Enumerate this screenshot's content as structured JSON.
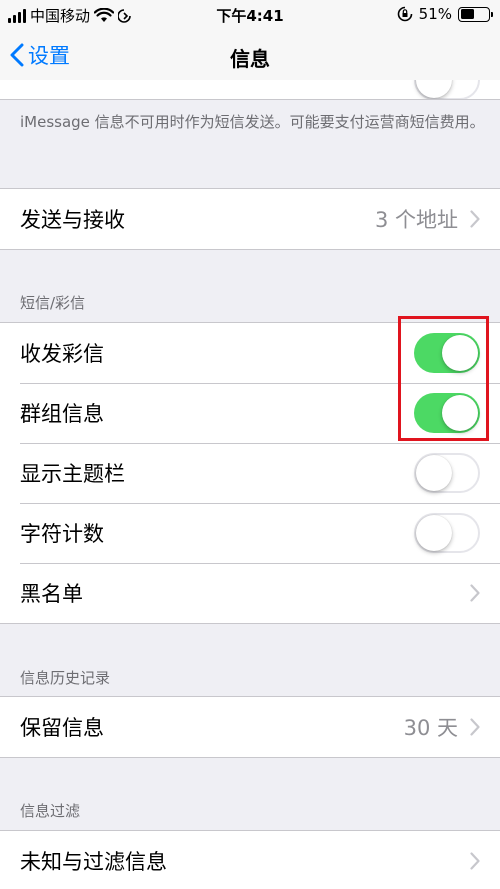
{
  "status_bar": {
    "carrier": "中国移动",
    "time": "下午4:41",
    "battery_percent": "51%",
    "battery_level": 0.51
  },
  "nav": {
    "back_label": "设置",
    "title": "信息"
  },
  "imessage_footnote": "iMessage 信息不可用时作为短信发送。可能要支付运营商短信费用。",
  "send_receive": {
    "label": "发送与接收",
    "value": "3 个地址"
  },
  "sms_section": {
    "header": "短信/彩信",
    "rows": [
      {
        "label": "收发彩信",
        "toggle": true
      },
      {
        "label": "群组信息",
        "toggle": true
      },
      {
        "label": "显示主题栏",
        "toggle": false
      },
      {
        "label": "字符计数",
        "toggle": false
      },
      {
        "label": "黑名单"
      }
    ]
  },
  "history_section": {
    "header": "信息历史记录",
    "keep_label": "保留信息",
    "keep_value": "30 天"
  },
  "filter_section": {
    "header": "信息过滤",
    "filter_label": "未知与过滤信息"
  },
  "colors": {
    "accent": "#007aff",
    "toggle_on": "#4cd964",
    "highlight": "#e0141e"
  }
}
